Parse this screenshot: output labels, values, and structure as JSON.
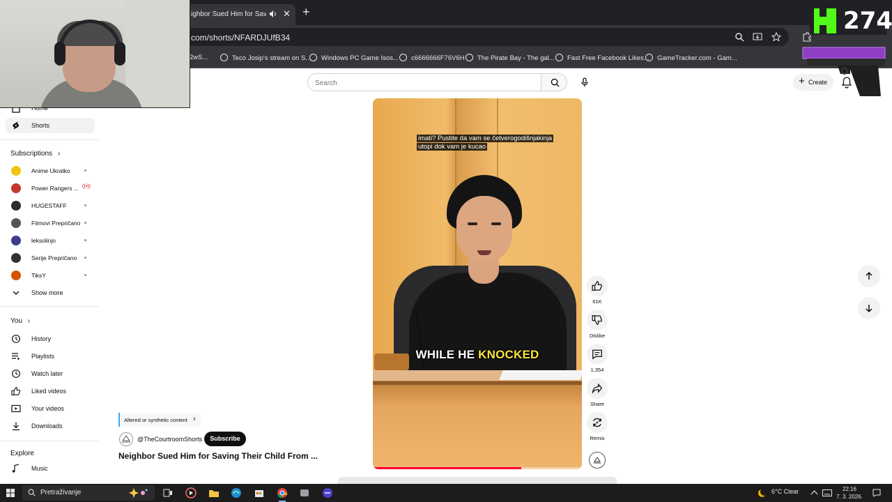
{
  "browser": {
    "tab_title": "ighbor Sued Him for Saving Th",
    "address": "com/shorts/NFARDJUfB34",
    "bookmarks": [
      "2wS...",
      "Teco Josip's stream on S...",
      "Windows PC Game Isos...",
      "c6666666F76V6H",
      "The Pirate Bay - The gal...",
      "Fast Free Facebook Likes...",
      "GameTracker.com - Gam..."
    ]
  },
  "masthead": {
    "search_placeholder": "Search",
    "create_label": "Create"
  },
  "sidebar": {
    "home": "Home",
    "shorts": "Shorts",
    "subscriptions_header": "Subscriptions",
    "subscriptions": [
      {
        "name": "Anime Ukratko",
        "color": "#f2c40f"
      },
      {
        "name": "Power Rangers ...",
        "color": "#c0392b",
        "live": "((•))"
      },
      {
        "name": "HUGESTAFF",
        "color": "#2c2c2c"
      },
      {
        "name": "Filmovi Prepričano",
        "color": "#555555"
      },
      {
        "name": "leksolinjo",
        "color": "#3b3b8f"
      },
      {
        "name": "Serije Prepričano",
        "color": "#333333"
      },
      {
        "name": "TiksY",
        "color": "#d35400"
      }
    ],
    "show_more": "Show more",
    "you_header": "You",
    "you_items": [
      "History",
      "Playlists",
      "Watch later",
      "Liked videos",
      "Your videos",
      "Downloads"
    ],
    "explore_header": "Explore",
    "explore_items": [
      "Music"
    ]
  },
  "short": {
    "caption_top_line1": "imati?  Pustite da vam se četverogodišnjakinja",
    "caption_top_line2": "utopi dok vam je kucao",
    "caption_big_white": "WHILE HE",
    "caption_big_yellow": "KNOCKED",
    "progress": 0.71,
    "likes": "61K",
    "dislike_label": "Dislike",
    "comments": "1,354",
    "share_label": "Share",
    "remix_label": "Remix"
  },
  "channel": {
    "altered_label": "Altered or synthetic content",
    "handle": "@TheCourtroomShorts",
    "subscribe_label": "Subscribe",
    "title": "Neighbor Sued Him for Saving Their Child From ..."
  },
  "overlay": {
    "kill_count": "274"
  },
  "taskbar": {
    "search_placeholder": "Pretraživanje",
    "weather": "6°C  Clear",
    "time": "22:16",
    "date": "7. 3. 2026."
  }
}
